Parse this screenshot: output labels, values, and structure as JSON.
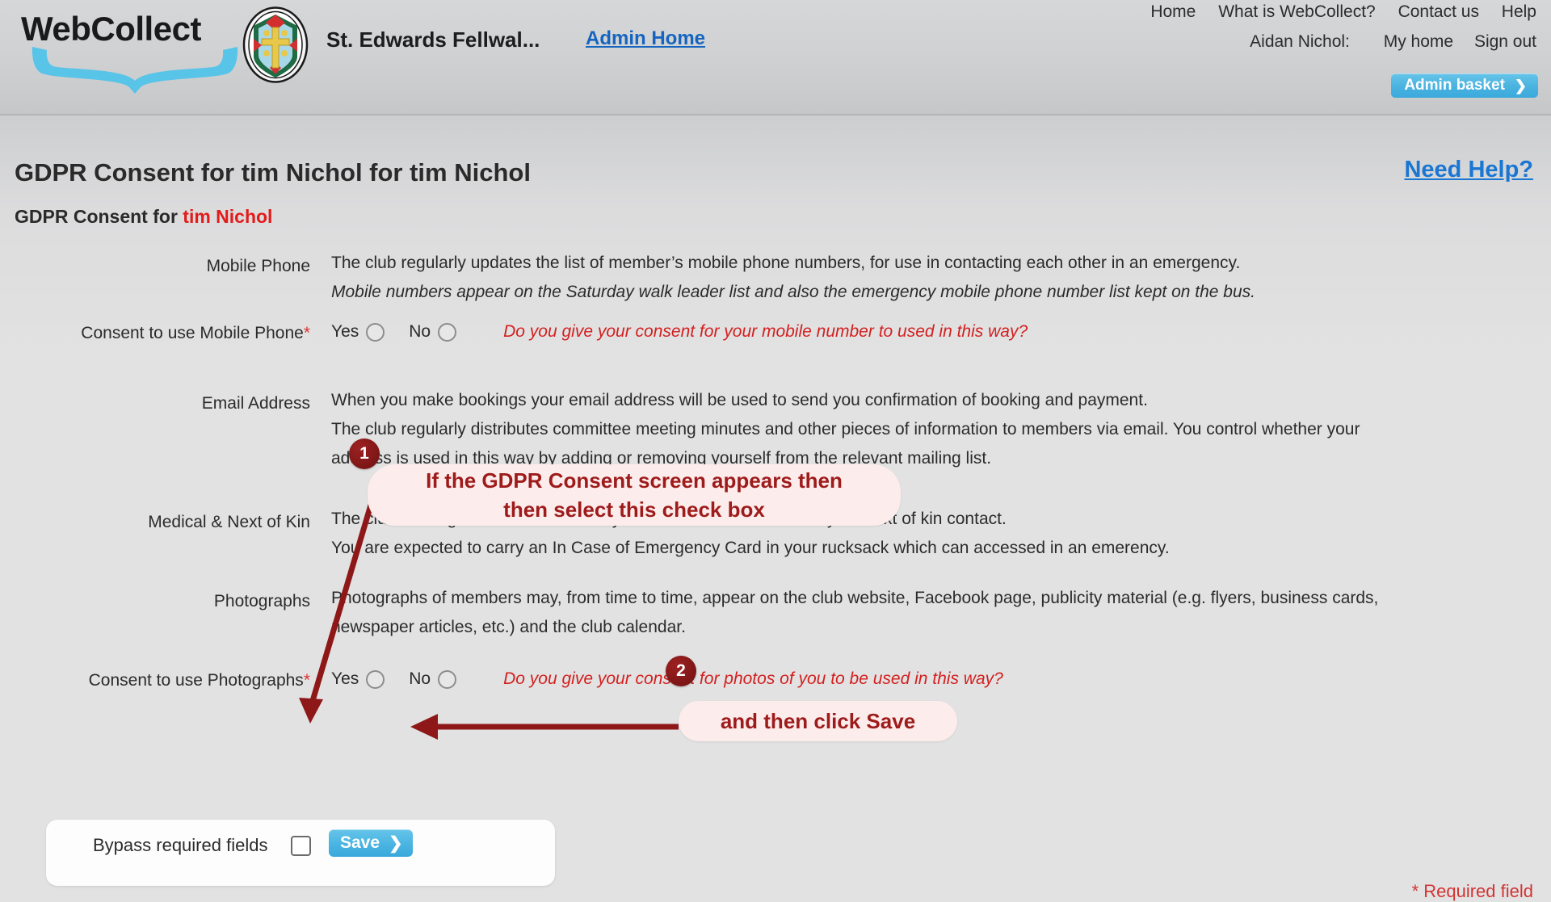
{
  "header": {
    "logo_text": "WebCollect",
    "club_name": "St. Edwards Fellwal...",
    "admin_home_label": "Admin Home",
    "nav_links": [
      {
        "label": "Home"
      },
      {
        "label": "What is WebCollect?"
      },
      {
        "label": "Contact us"
      },
      {
        "label": "Help"
      }
    ],
    "user_name": "Aidan Nichol:",
    "user_links": [
      {
        "label": "My home"
      },
      {
        "label": "Sign out"
      }
    ],
    "admin_basket_label": "Admin basket",
    "admin_basket_chevron": "❯"
  },
  "page": {
    "title": "GDPR Consent for tim Nichol for tim Nichol",
    "need_help_label": "Need Help?",
    "subtitle_prefix": "GDPR Consent for ",
    "subtitle_member": "tim Nichol",
    "required_note": "* Required field"
  },
  "sections": {
    "mobile_phone": {
      "label": "Mobile Phone",
      "line1": "The club regularly updates the list of member’s mobile phone numbers, for use in contacting each other in an emergency.",
      "line2": "Mobile numbers appear on the Saturday walk leader list and also the emergency mobile phone number list kept on the bus."
    },
    "consent_mobile": {
      "label": "Consent to use Mobile Phone",
      "required_mark": "*",
      "yes_label": "Yes",
      "no_label": "No",
      "hint": "Do you give your consent for your mobile number to used in this way?"
    },
    "email_address": {
      "label": "Email Address",
      "line1": "When you make bookings your email address will be used to send you confirmation of booking and payment.",
      "line2": " The club regularly distributes committee meeting minutes and other pieces of information to members via email.  You control whether your",
      "line3": "address is used in this way by adding or removing yourself from the relevant mailing list."
    },
    "medical_kin": {
      "label": "Medical & Next of Kin",
      "line1": "The club no longer retains records of your medical conditions and your next of kin contact.",
      "line2": "You are expected to carry an In Case of Emergency Card in your rucksack which can accessed in an emerency."
    },
    "photographs": {
      "label": "Photographs",
      "line1": "Photographs of members may, from time to time, appear on the club website, Facebook page, publicity material (e.g. flyers, business cards,",
      "line2": "newspaper articles, etc.) and the club calendar."
    },
    "consent_photos": {
      "label": "Consent to use Photographs",
      "required_mark": "*",
      "yes_label": "Yes",
      "no_label": "No",
      "hint": "Do you give your consent for photos of you to be used in this way?"
    },
    "save_panel": {
      "bypass_label": "Bypass required fields",
      "save_label": "Save",
      "save_chevron": "❯"
    }
  },
  "annotations": {
    "accent_color": "#9e1b1b",
    "items": [
      {
        "badge": "1",
        "line1": "If the GDPR Consent screen appears then",
        "line2": "then select  this check box"
      },
      {
        "badge": "2",
        "text": "and then click Save"
      }
    ]
  }
}
